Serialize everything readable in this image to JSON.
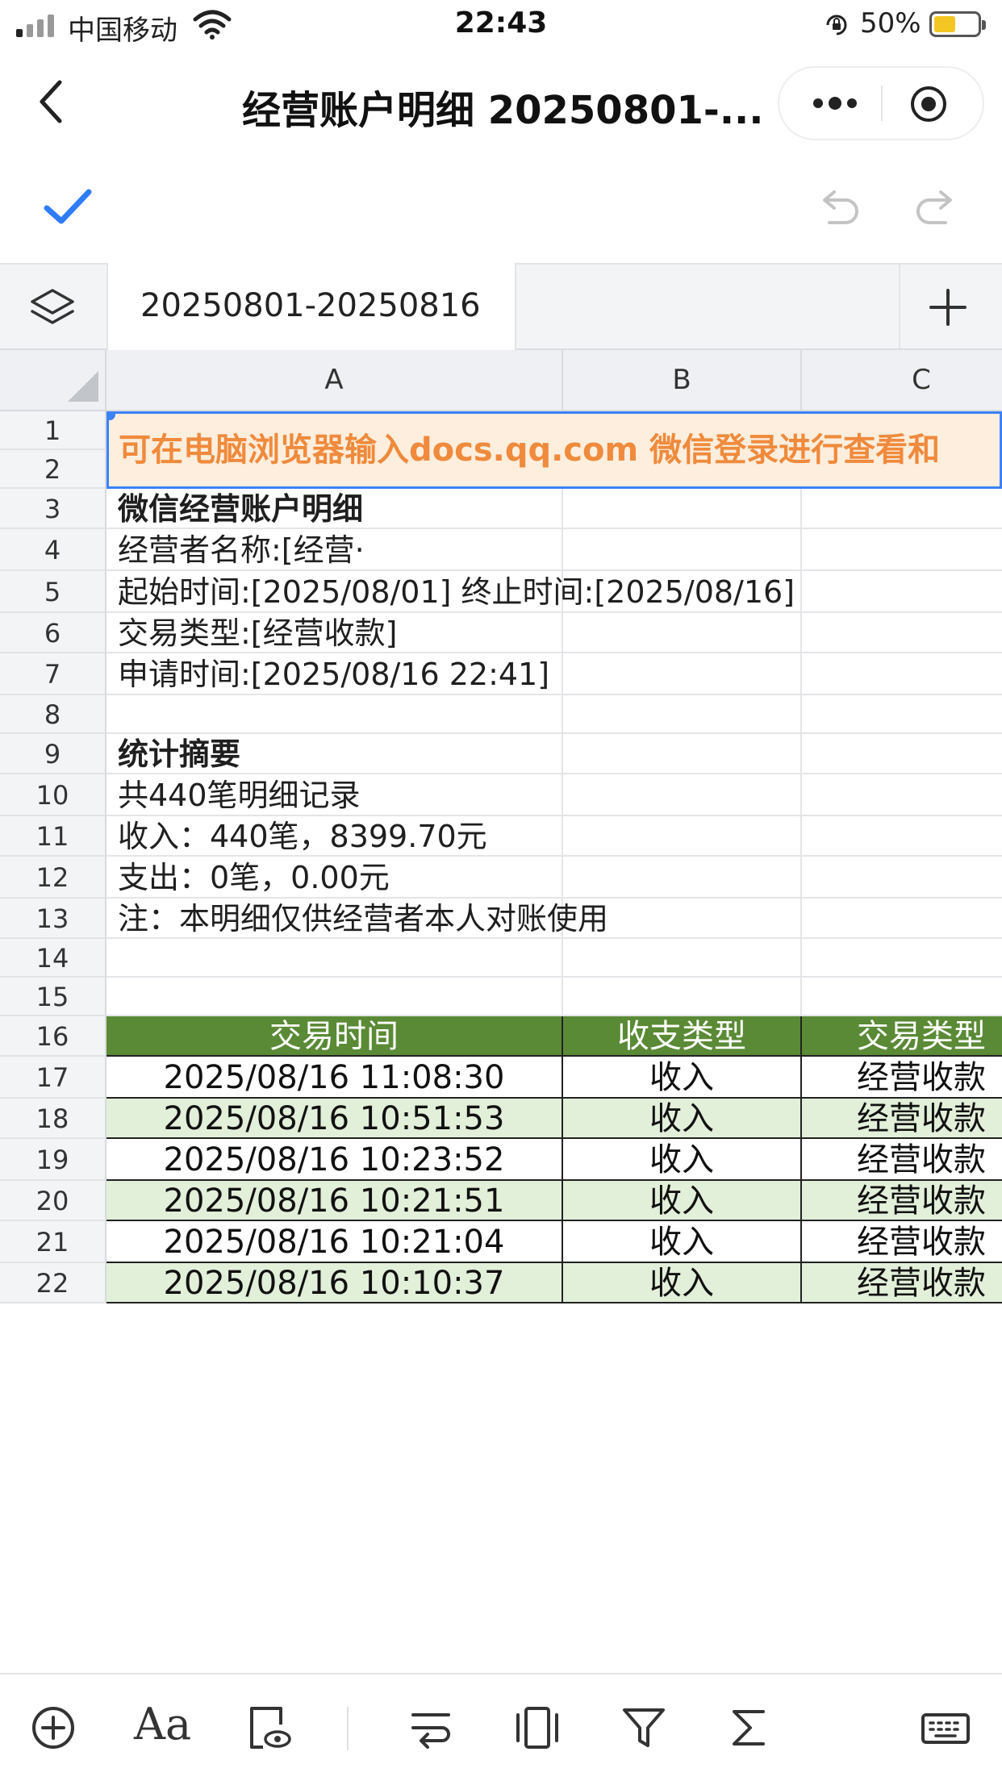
{
  "status_bar": {
    "carrier": "中国移动",
    "time": "22:43",
    "battery_percent": "50%",
    "battery_level": 0.5,
    "battery_color": "#f3c623"
  },
  "nav": {
    "title": "经营账户明细 20250801-...",
    "back_icon": "chevron-left-icon",
    "more_icon": "more-dots-icon",
    "close_icon": "target-circle-icon"
  },
  "edit_toolbar": {
    "confirm_icon": "check-icon",
    "undo_icon": "undo-icon",
    "redo_icon": "redo-icon"
  },
  "sheet_tabs": {
    "active_tab": "20250801-20250816",
    "layers_icon": "layers-icon",
    "add_icon": "plus-icon"
  },
  "grid": {
    "columns": [
      "A",
      "B",
      "C"
    ],
    "row_numbers": [
      "1",
      "2",
      "3",
      "4",
      "5",
      "6",
      "7",
      "8",
      "9",
      "10",
      "11",
      "12",
      "13",
      "14",
      "15",
      "16",
      "17",
      "18",
      "19",
      "20",
      "21",
      "22"
    ],
    "banner_text": "可在电脑浏览器输入docs.qq.com 微信登录进行查看和",
    "info": {
      "r3": "微信经营账户明细",
      "r4": "经营者名称:[经营·",
      "r5": "起始时间:[2025/08/01] 终止时间:[2025/08/16]",
      "r6": "交易类型:[经营收款]",
      "r7": "申请时间:[2025/08/16 22:41]",
      "r9": "统计摘要",
      "r10": "共440笔明细记录",
      "r11": "收入：440笔，8399.70元",
      "r12": "支出：0笔，0.00元",
      "r13": "注：本明细仅供经营者本人对账使用"
    },
    "table_header": [
      "交易时间",
      "收支类型",
      "交易类型"
    ],
    "table_rows": [
      [
        "2025/08/16 11:08:30",
        "收入",
        "经营收款"
      ],
      [
        "2025/08/16 10:51:53",
        "收入",
        "经营收款"
      ],
      [
        "2025/08/16 10:23:52",
        "收入",
        "经营收款"
      ],
      [
        "2025/08/16 10:21:51",
        "收入",
        "经营收款"
      ],
      [
        "2025/08/16 10:21:04",
        "收入",
        "经营收款"
      ],
      [
        "2025/08/16 10:10:37",
        "收入",
        "经营收款"
      ]
    ],
    "colors": {
      "header_green": "#5a8a35",
      "alt_row_green": "#e2efd9",
      "banner_bg": "#fdeede",
      "banner_text": "#f08a3c",
      "selection_blue": "#3b82f6"
    }
  },
  "bottom_toolbar": {
    "items": [
      "plus-circle-icon",
      "font-icon",
      "view-icon",
      "wrap-text-icon",
      "freeze-icon",
      "filter-icon",
      "sum-icon",
      "keyboard-icon"
    ],
    "font_label": "Aa"
  }
}
